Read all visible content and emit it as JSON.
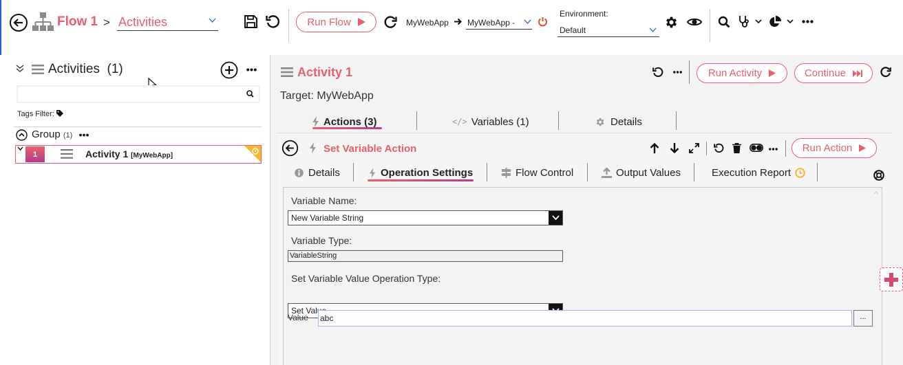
{
  "header": {
    "flow_name": "Flow 1",
    "breadcrumb_sep": ">",
    "activities_combo": "Activities",
    "run_flow_label": "Run Flow",
    "app_source": "MyWebApp",
    "app_target": "MyWebApp -",
    "environment_label": "Environment:",
    "environment_value": "Default"
  },
  "activities_panel": {
    "title": "Activities",
    "count": "(1)",
    "search_placeholder": "",
    "tags_filter_label": "Tags Filter:",
    "group": {
      "name": "Group",
      "count": "(1)"
    },
    "items": [
      {
        "index": "1",
        "name": "Activity 1",
        "target": "[MyWebApp]"
      }
    ]
  },
  "activity": {
    "title": "Activity 1",
    "target_text": "Target: MyWebApp",
    "run_activity_label": "Run Activity",
    "continue_label": "Continue",
    "tabs": [
      {
        "label": "Actions (3)"
      },
      {
        "label": "Variables (1)"
      },
      {
        "label": "Details"
      }
    ]
  },
  "action": {
    "title": "Set Variable Action",
    "run_action_label": "Run Action",
    "tabs": [
      {
        "label": "Details"
      },
      {
        "label": "Operation Settings"
      },
      {
        "label": "Flow Control"
      },
      {
        "label": "Output Values"
      },
      {
        "label": "Execution Report"
      }
    ]
  },
  "form": {
    "variable_name_label": "Variable Name:",
    "variable_name_value": "New Variable String",
    "variable_type_label": "Variable Type:",
    "variable_type_value": "VariableString",
    "operation_type_label": "Set Variable Value Operation Type:",
    "operation_type_value": "Set Value",
    "value_label": "Value",
    "value_value": "abc",
    "browse_label": "..."
  },
  "colors": {
    "accent": "#e8616a",
    "accent_dark": "#b43c8f",
    "panel_bg": "#f3f3f4"
  }
}
